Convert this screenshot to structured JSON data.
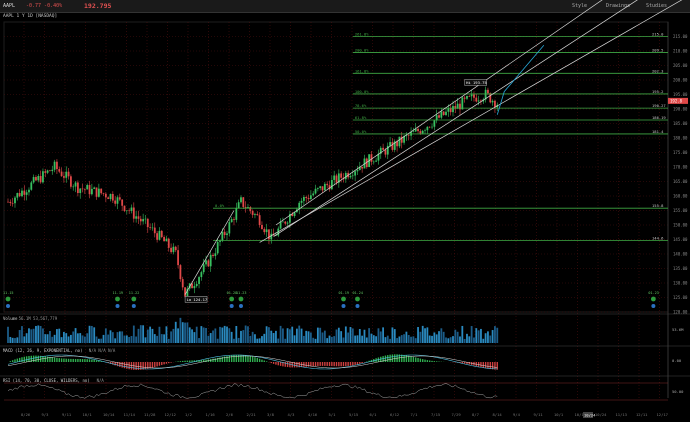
{
  "header": {
    "symbol": "AAPL",
    "change_text": "-0.77 -0.40%",
    "last": "192.795",
    "buttons": [
      "Style",
      "Drawings",
      "Studies"
    ]
  },
  "chart_title": "AAPL 1 Y 1D [NASDAQ]",
  "colors": {
    "up": "#38c060",
    "down": "#e04848",
    "fib": "#3faa44",
    "channel": "#d8d8d8",
    "accent": "#29a8d8"
  },
  "price_chart": {
    "type": "candlestick",
    "ylim": [
      120,
      220
    ],
    "y_ticks": [
      215,
      210,
      205,
      200,
      195,
      190,
      185,
      180,
      175,
      170,
      165,
      160,
      155,
      150,
      145,
      140,
      135,
      130,
      125,
      120
    ],
    "x_ticks": [
      "8/26",
      "9/3",
      "9/11",
      "10/1",
      "10/14",
      "11/14",
      "11/28",
      "12/12",
      "1/2",
      "1/16",
      "2/6",
      "2/21",
      "3/8",
      "4/3",
      "4/16",
      "5/1",
      "5/15",
      "6/1",
      "6/12",
      "7/1",
      "7/15",
      "7/29",
      "8/7",
      "8/14",
      "9/4",
      "9/11",
      "10/1",
      "10/10",
      "10/24",
      "11/13",
      "12/11",
      "12/17"
    ],
    "fib_levels": [
      {
        "label": "261.8%",
        "price": 215.0,
        "value_label": "215.0"
      },
      {
        "label": "200.0%",
        "price": 209.5,
        "value_label": "209.5"
      },
      {
        "label": "161.8%",
        "price": 202.3,
        "value_label": "202.3"
      },
      {
        "label": "100.0%",
        "price": 195.2,
        "value_label": "195.2"
      },
      {
        "label": "78.6%",
        "price": 190.3,
        "value_label": "190.27"
      },
      {
        "label": "61.8%",
        "price": 186.2,
        "value_label": "186.19"
      },
      {
        "label": "50.0%",
        "price": 181.4,
        "value_label": "181.4"
      },
      {
        "label": "0.0%",
        "price": 155.8,
        "value_label": "155.8"
      },
      {
        "label": "",
        "price": 144.6,
        "value_label": "144.6"
      }
    ],
    "last_price_label": "192.8",
    "annotations": [
      {
        "text": "Hi 193.75",
        "x_idx": 196,
        "price": 199.0
      },
      {
        "text": "Lo 124.17",
        "x_idx": 76,
        "price": 124.2
      }
    ],
    "event_markers": [
      {
        "text": "11.15",
        "x_idx": 0
      },
      {
        "text": "11.19",
        "x_idx": 47
      },
      {
        "text": "11.22",
        "x_idx": 54
      },
      {
        "text": "01.28",
        "x_idx": 96
      },
      {
        "text": "11.23",
        "x_idx": 100
      },
      {
        "text": "01.19",
        "x_idx": 144
      },
      {
        "text": "01.24",
        "x_idx": 150
      },
      {
        "text": "01.23",
        "x_idx": 277
      }
    ]
  },
  "volume_panel": {
    "label": "Volume",
    "info": "56.1M  53,567,779",
    "right_value": "53.6M"
  },
  "macd_panel": {
    "label": "MACD (12, 26, 9, EXPONENTIAL, no)",
    "info": "N/A  N/A  N/A",
    "right_value": "0.00"
  },
  "rsi_panel": {
    "label": "RSI (14, 70, 30, CLOSE, WILDERS, no)",
    "info": "N/A",
    "right_value": "50.00"
  },
  "time_highlight": "10/24"
}
